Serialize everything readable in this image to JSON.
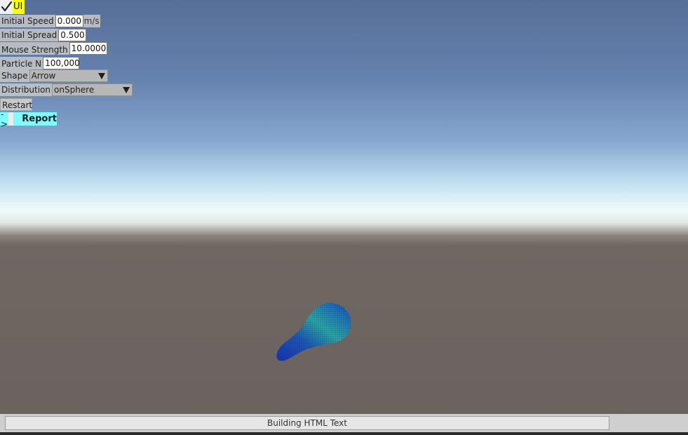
{
  "ui_toggle": {
    "label": "UI",
    "checked": true
  },
  "controls": {
    "initial_speed": {
      "label": "Initial Speed",
      "value": "0.000",
      "unit": "m/s"
    },
    "initial_spread": {
      "label": "Initial Spread",
      "value": "0.500"
    },
    "mouse_strength": {
      "label": "Mouse Strength",
      "value": "10.0000"
    },
    "particle_n": {
      "label": "Particle N",
      "value": "100,000"
    },
    "shape": {
      "label": "Shape",
      "selected": "Arrow"
    },
    "distribution": {
      "label": "Distribution",
      "selected": "onSphere"
    }
  },
  "restart_label": "Restart",
  "report": {
    "arrow": "->",
    "label": "Report"
  },
  "status": {
    "text": "Building HTML Text"
  },
  "colors": {
    "toggle_highlight": "#ffff00",
    "report_bg": "#7dfbfd",
    "particle_blue": "#1b3fa8",
    "particle_teal": "#2fb9a6"
  }
}
